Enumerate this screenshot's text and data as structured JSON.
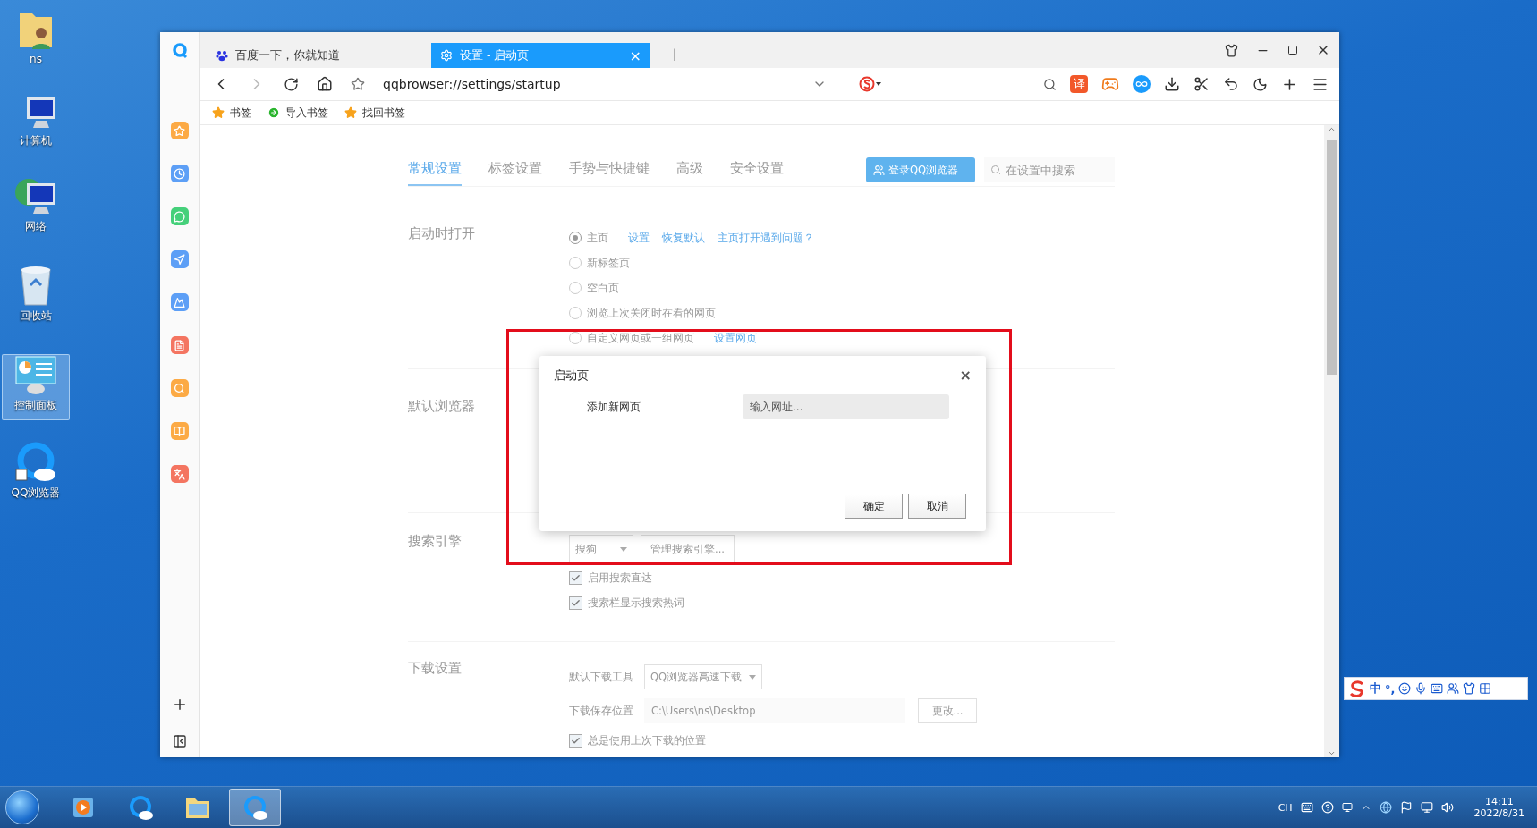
{
  "desktop_icons": [
    {
      "kind": "user-folder",
      "label": "ns",
      "selected": false
    },
    {
      "kind": "computer",
      "label": "计算机",
      "selected": false
    },
    {
      "kind": "network",
      "label": "网络",
      "selected": false
    },
    {
      "kind": "recycle",
      "label": "回收站",
      "selected": false
    },
    {
      "kind": "control-panel",
      "label": "控制面板",
      "selected": true
    },
    {
      "kind": "browser",
      "label": "QQ浏览器",
      "selected": false
    }
  ],
  "browser": {
    "tabs": [
      {
        "kind": "baidu",
        "label": "百度一下，你就知道",
        "selected": false
      },
      {
        "kind": "settings",
        "label": "设置 - 启动页",
        "selected": true,
        "close": "×"
      }
    ],
    "new_tab": "+",
    "address": "qqbrowser://settings/startup",
    "toolbar_badge": "译",
    "bookmarks": [
      {
        "kind": "star",
        "label": "书签"
      },
      {
        "kind": "import",
        "label": "导入书签"
      },
      {
        "kind": "star",
        "label": "找回书签"
      }
    ]
  },
  "settings": {
    "tabs": [
      {
        "label": "常规设置",
        "selected": true
      },
      {
        "label": "标签设置",
        "selected": false
      },
      {
        "label": "手势与快捷键",
        "selected": false
      },
      {
        "label": "高级",
        "selected": false
      },
      {
        "label": "安全设置",
        "selected": false
      }
    ],
    "login_button": "登录QQ浏览器",
    "search": {
      "placeholder": "在设置中搜索"
    },
    "startup": {
      "title": "启动时打开",
      "options": [
        {
          "label": "主页",
          "selected": true,
          "links": [
            "设置",
            "恢复默认",
            "主页打开遇到问题？"
          ]
        },
        {
          "label": "新标签页",
          "selected": false
        },
        {
          "label": "空白页",
          "selected": false
        },
        {
          "label": "浏览上次关闭时在看的网页",
          "selected": false
        },
        {
          "label": "自定义网页或一组网页",
          "selected": false,
          "links": [
            "设置网页"
          ]
        }
      ]
    },
    "default_browser": {
      "title": "默认浏览器"
    },
    "search_engine": {
      "title": "搜索引擎",
      "engine": "搜狗",
      "manage_button": "管理搜索引擎...",
      "checks": [
        {
          "label": "启用搜索直达",
          "checked": true
        },
        {
          "label": "搜索栏显示搜索热词",
          "checked": true
        }
      ]
    },
    "download": {
      "title": "下载设置",
      "tool_label": "默认下载工具",
      "tool": "QQ浏览器高速下载",
      "path_label": "下载保存位置",
      "path": "C:\\Users\\ns\\Desktop",
      "change_button": "更改...",
      "checks": [
        {
          "label": "总是使用上次下载的位置",
          "checked": true
        }
      ]
    }
  },
  "dialog": {
    "title": "启动页",
    "close": "×",
    "row_label": "添加新网页",
    "input": {
      "placeholder": "输入网址..."
    },
    "buttons": [
      "确定",
      "取消"
    ]
  },
  "ime_bar": {
    "mode": "中",
    "punct": "°,"
  },
  "taskbar": {
    "apps": [
      {
        "kind": "media",
        "selected": false
      },
      {
        "kind": "browser",
        "selected": false
      },
      {
        "kind": "explorer",
        "selected": false
      },
      {
        "kind": "browser",
        "selected": true
      }
    ],
    "language": "CH",
    "time": "14:11",
    "date": "2022/8/31"
  }
}
